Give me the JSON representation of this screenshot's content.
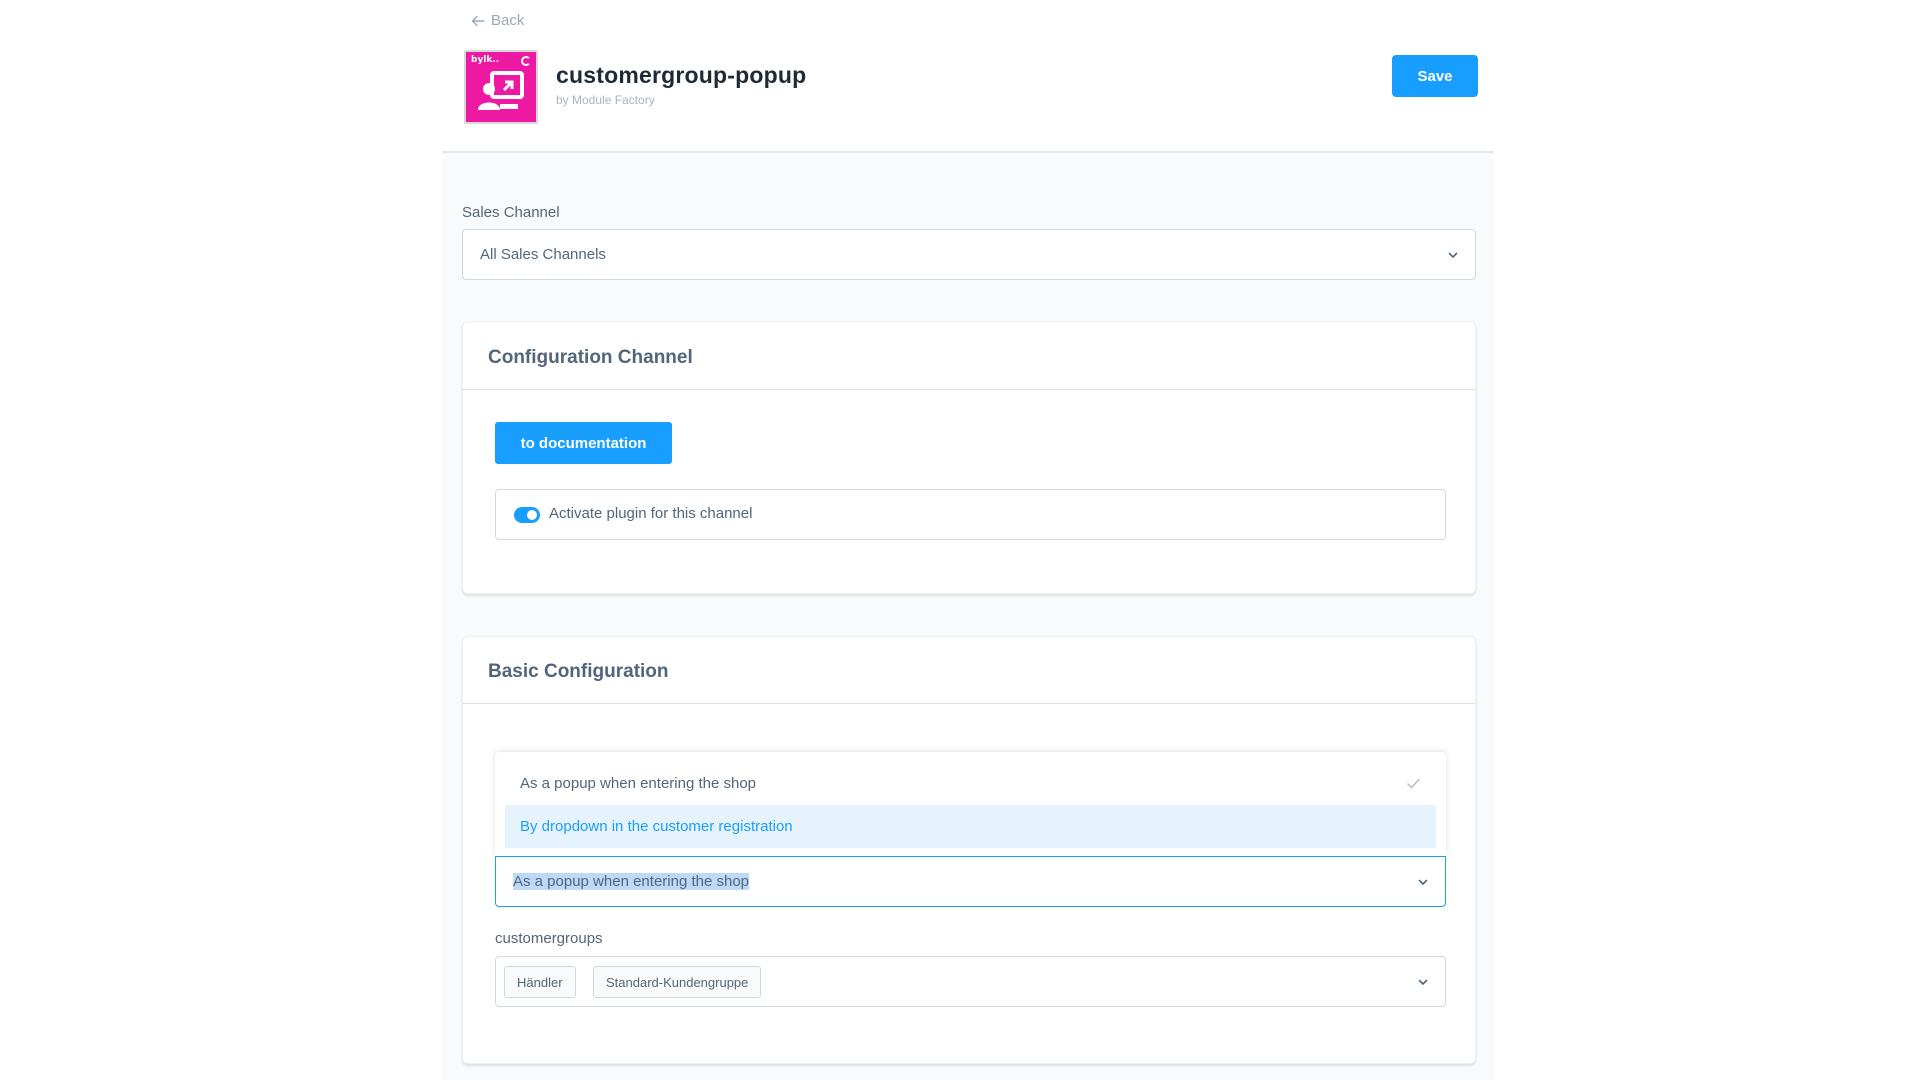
{
  "header": {
    "back_label": "Back",
    "plugin_brand": "bylk..",
    "title": "customergroup-popup",
    "subtitle": "by Module Factory",
    "save_label": "Save"
  },
  "sales_channel": {
    "label": "Sales Channel",
    "value": "All Sales Channels"
  },
  "config_channel_card": {
    "title": "Configuration Channel",
    "doc_button": "to documentation",
    "toggle_label": "Activate plugin for this channel",
    "toggle_on": true
  },
  "basic_config_card": {
    "title": "Basic Configuration",
    "dropdown_options": [
      {
        "label": "As a popup when entering the shop",
        "selected": true
      },
      {
        "label": "By dropdown in the customer registration",
        "hovered": true
      }
    ],
    "select_value": "As a popup when entering the shop",
    "customergroups_label": "customergroups",
    "customergroups_tags": [
      "Händler",
      "Standard-Kundengruppe"
    ]
  },
  "colors": {
    "primary": "#189eff",
    "plugin_icon_bg": "#ee19a2",
    "text": "#52667a"
  }
}
